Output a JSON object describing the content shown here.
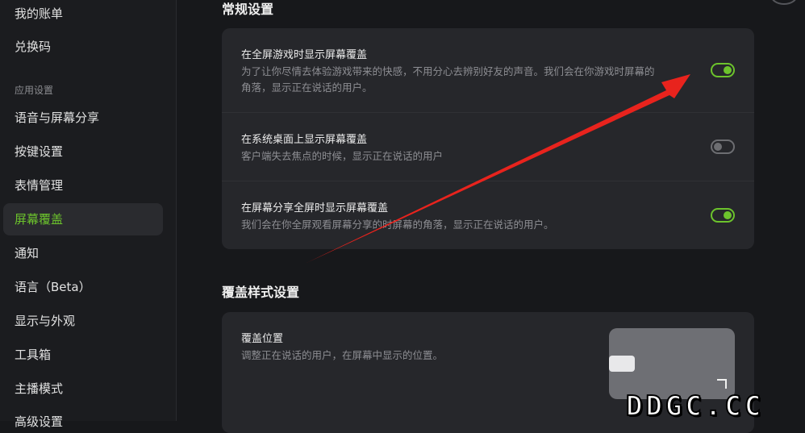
{
  "sidebar": {
    "items_top": [
      "我的账单",
      "兑换码"
    ],
    "section_label": "应用设置",
    "items": [
      "语音与屏幕分享",
      "按键设置",
      "表情管理",
      "屏幕覆盖",
      "通知",
      "语言（Beta）",
      "显示与外观",
      "工具箱",
      "主播模式",
      "高级设置"
    ],
    "active_item": "屏幕覆盖"
  },
  "general": {
    "title": "常规设置",
    "rows": [
      {
        "title": "在全屏游戏时显示屏幕覆盖",
        "desc": "为了让你尽情去体验游戏带来的快感，不用分心去辨别好友的声音。我们会在你游戏时屏幕的角落，显示正在说话的用户。",
        "enabled": true
      },
      {
        "title": "在系统桌面上显示屏幕覆盖",
        "desc": "客户端失去焦点的时候，显示正在说话的用户",
        "enabled": false
      },
      {
        "title": "在屏幕分享全屏时显示屏幕覆盖",
        "desc": "我们会在你全屏观看屏幕分享的时屏幕的角落，显示正在说话的用户。",
        "enabled": true
      }
    ]
  },
  "style": {
    "title": "覆盖样式设置",
    "position": {
      "title": "覆盖位置",
      "desc": "调整正在说话的用户，在屏幕中显示的位置。"
    }
  },
  "watermark": "DDGC.CC",
  "colors": {
    "accent": "#6cc32c",
    "arrow": "#e8231d",
    "background": "#17181b",
    "card": "#26272b"
  }
}
